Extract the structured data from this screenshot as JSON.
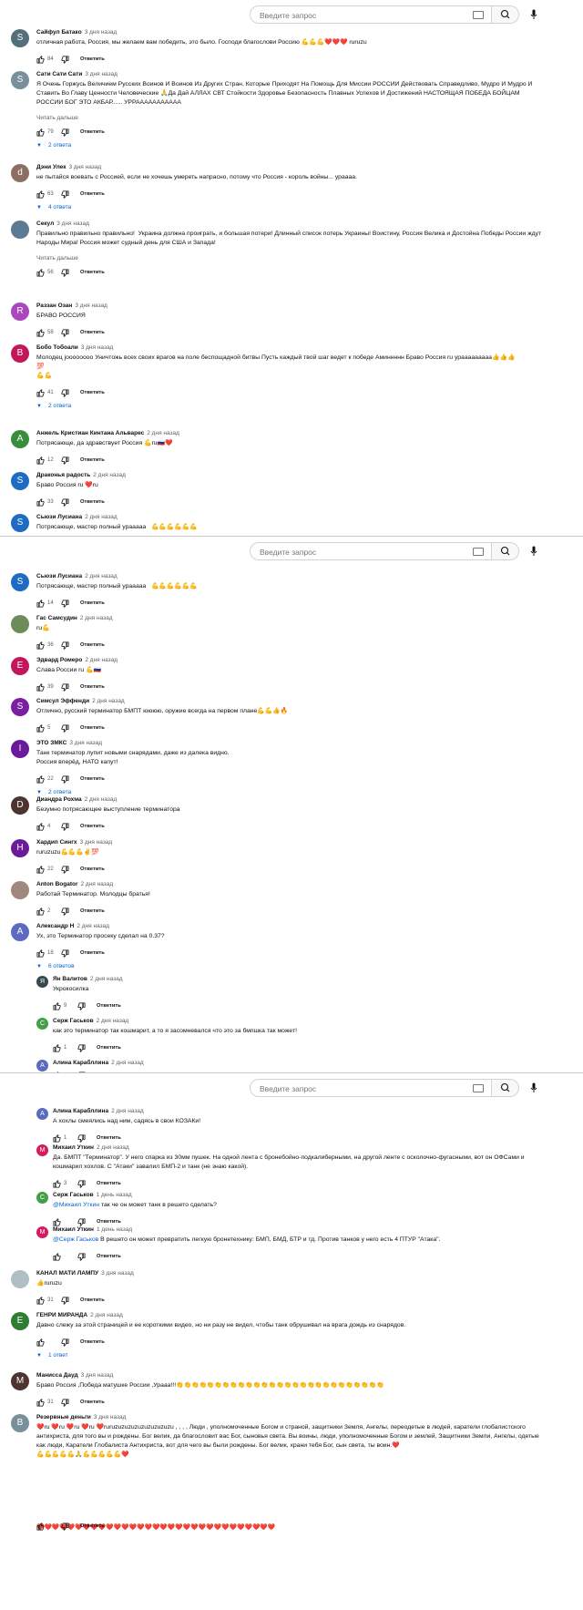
{
  "search": {
    "placeholder": "Введите запрос"
  },
  "segment1": {
    "comments": [
      {
        "initial": "S",
        "color": "#546e7a",
        "author": "Сайфул Батако",
        "date": "3 дня назад",
        "text": "отличная работа, Россия, мы желаем вам победить, это было. Господи благослови Россию 💪💪💪❤️❤️❤️ ruruzu",
        "likes": "84"
      },
      {
        "initial": "S",
        "color": "#78909c",
        "author": "Сати Сати Сати",
        "date": "3 дня назад",
        "text": "Я Очень Горжусь Величием Русских Воинов И Воинов Из Других Стран, Которые Приходят На Помощь Для Миссии РОССИИ Действовать Справедливо, Мудро И Мудро И Ставить Во Главу Ценности Человеческие 🙏Да Дай АЛЛАХ СВТ Стойкости Здоровье Безопасность Плавных Успехов И Достижений НАСТОЯЩАЯ ПОБЕДА БОЙЦАМ РОССИИ БОГ ЭТО АКБАР...... УРРААААААААААА",
        "more": "Читать дальше",
        "likes": "79",
        "replies": "2 ответа"
      },
      {
        "initial": "d",
        "color": "#8d6e63",
        "author": "Дэни Улек",
        "date": "3 дня назад",
        "text": "не пытайся воевать с Россией, если не хочешь умереть напрасно, потому что Россия - король войны... ураааа.",
        "likes": "63",
        "replies": "4 ответа"
      },
      {
        "initial": "",
        "color": "#5d7a94",
        "author": "Секул",
        "date": "3 дня назад",
        "text": "Правильно правильно правильно!  Украина должна проиграть, и большая потери! Длинный список потерь Украины! Воистину, Россия Велика и Достойна Победы России ждут Народы Мира! Россия может судный день для США и Запада!",
        "more": "Читать дальше",
        "likes": "56"
      },
      {
        "initial": "R",
        "color": "#ab47bc",
        "author": "Раззан Озан",
        "date": "3 дня назад",
        "text": "БРАВО РОССИЯ",
        "likes": "58"
      },
      {
        "initial": "B",
        "color": "#c2185b",
        "author": "Бобо Тобоали",
        "date": "3 дня назад",
        "text": "Молодец joooooooo Уничтожь всех своих врагов на поле беспощадной битвы Пусть каждый твой шаг ведет к победе Аминнннн Браво Россия ru урааааааааа👍👍👍\n💯\n💪💪",
        "likes": "41",
        "replies": "2 ответа"
      },
      {
        "initial": "A",
        "color": "#388e3c",
        "author": "Анжель Кристиан Кинтана Альварес",
        "date": "2 дня назад",
        "text": "Потрясающе, да здравствует Россия 💪ru🇷🇺❤️",
        "likes": "12"
      },
      {
        "initial": "S",
        "color": "#1e6bc4",
        "author": "Драконья радость",
        "date": "2 дня назад",
        "text": "Браво Россия ru ❤️ru",
        "likes": "33"
      },
      {
        "initial": "S",
        "color": "#1e6bc4",
        "author": "Сьюзи Лусиана",
        "date": "2 дня назад",
        "text": "Потрясающе, мастер полный урааааа   💪💪💪💪💪💪",
        "likes": ""
      }
    ]
  },
  "segment2": {
    "comments": [
      {
        "initial": "S",
        "color": "#1e6bc4",
        "author": "Сьюзи Лусиана",
        "date": "2 дня назад",
        "text": "Потрясающе, мастер полный урааааа   💪💪💪💪💪💪",
        "likes": "14"
      },
      {
        "initial": "",
        "color": "#6d8c5a",
        "author": "Гас Самсудин",
        "date": "2 дня назад",
        "text": "ru💪",
        "likes": "36"
      },
      {
        "initial": "E",
        "color": "#c2185b",
        "author": "Эдвард Ромеро",
        "date": "2 дня назад",
        "text": "Слава России ru 💪🇷🇺",
        "likes": "39"
      },
      {
        "initial": "S",
        "color": "#7b1fa2",
        "author": "Симсул Эффенди",
        "date": "2 дня назад",
        "text": "Отлично, русский терминатор БМПТ юююю, оружие всегда на первом плане💪💪👍🔥",
        "likes": "5"
      },
      {
        "initial": "I",
        "color": "#6a1b9a",
        "author": "ЭТО ЗМКС",
        "date": "3 дня назад",
        "text": "Танк терминатор лупит новыми снарядами, даже из далека видно.\nРоссия вперёд, НАТО капут!",
        "likes": "22",
        "replies": "2 ответа"
      },
      {
        "initial": "D",
        "color": "#4e342e",
        "author": "Диандра Рохма",
        "date": "2 дня назад",
        "text": "Безумно потрясающее выступление терминатора",
        "likes": "4"
      },
      {
        "initial": "H",
        "color": "#6a1b9a",
        "author": "Хардип Сингх",
        "date": "3 дня назад",
        "text": "ruruzuzu💪💪💪✌️💯",
        "likes": "22"
      },
      {
        "initial": "",
        "color": "#a1887f",
        "author": "Anton Bogator",
        "date": "2 дня назад",
        "text": "Работай Терминатор. Молодцы братья!",
        "likes": "2"
      },
      {
        "initial": "A",
        "color": "#5c6bc0",
        "author": "Александр Н",
        "date": "2 дня назад",
        "text": "Ух, это Терминатор просеку сделал на 0.37?",
        "likes": "18",
        "replies": "6 ответов"
      }
    ],
    "replies": [
      {
        "initial": "Я",
        "color": "#37474f",
        "author": "Ян Валитов",
        "date": "2 дня назад",
        "text": "Укрокосилка",
        "likes": "9"
      },
      {
        "initial": "C",
        "color": "#43a047",
        "author": "Серж Гаськов",
        "date": "2 дня назад",
        "text": "как это терминатор так кошмарит, а то я засомневался что это за бмпшка так может!",
        "likes": "1"
      },
      {
        "initial": "A",
        "color": "#5c6bc0",
        "author": "Алина Карабллина",
        "date": "2 дня назад",
        "text": "",
        "likes": ""
      }
    ]
  },
  "segment3": {
    "replies": [
      {
        "initial": "A",
        "color": "#5c6bc0",
        "author": "Алина Карабллина",
        "date": "2 дня назад",
        "text": "А хохлы смеялись над ним, садясь в свои КОЗАКи!",
        "likes": "1"
      },
      {
        "initial": "M",
        "color": "#d81b60",
        "author": "Михаил Уткин",
        "date": "2 дня назад",
        "text": "Да. БМПТ \"Терминатор\". У него спарка из 30мм пушек. На одной лента с бронебойно-подкалиберными, на другой ленте с осколочно-фугасными, вот он ОФСами и кошмарил хохлов. С \"Атаки\" завалил БМП-2 и танк (не знаю какой).",
        "likes": "3"
      },
      {
        "initial": "C",
        "color": "#43a047",
        "author": "Серж Гаськов",
        "date": "1 день назад",
        "mention": "@Михаил Уткин",
        "text": " так че он может танк в решето сделать?",
        "likes": ""
      },
      {
        "initial": "M",
        "color": "#d81b60",
        "author": "Михаил Уткин",
        "date": "1 день назад",
        "mention": "@Серж Гаськов",
        "text": " В решето он может превратить легкую бронетехнику: БМП, БМД, БТР и тд. Против танков у него есть 4 ПТУР \"Атака\".",
        "likes": ""
      }
    ],
    "comments": [
      {
        "initial": "",
        "color": "#b0bec5",
        "author": "КАНАЛ МАТИ ЛАМПУ",
        "date": "3 дня назад",
        "text": "👍ruruzu",
        "likes": "31"
      },
      {
        "initial": "E",
        "color": "#2e7d32",
        "author": "ГЕНРИ МИРАНДА",
        "date": "2 дня назад",
        "text": "Давно слежу за этой страницей и ее короткими видео, но ни разу не видел, чтобы танк обрушивал на врага дождь из снарядов.",
        "likes": "",
        "replies": "1 ответ"
      },
      {
        "initial": "M",
        "color": "#4e342e",
        "author": "Манисса Дауд",
        "date": "3 дня назад",
        "text": "Браво Россия ,Победа матушке России ,Урааа!!!👏👏👏👏👏👏👏👏👏👏👏👏👏👏👏👏👏👏👏👏👏👏👏👏👏👏👏",
        "likes": "31"
      },
      {
        "initial": "B",
        "color": "#78909c",
        "author": "Резервные деньги",
        "date": "3 дня назад",
        "text": "❤️ru ❤️ru ❤️ru ❤️ru ❤️ruruzuzuzuzuzuzuzuzuzu , , , , Люди , уполномоченные Богом и страной, защитники Земля, Ангелы, переодетые в людей, каратели глобалистского антихриста, для того вы и рождены. Бог велик, да благословит вас Бог, сыновья света. Вы воины, люди, уполномоченные Богом и землей, Защитники Земли, Ангелы, одетые как люди, Каратели Глобалиста Антихриста, вот для чего вы были рождены. Бог велик, храни тебя Бог, сын света, ты воин.❤️\n💪💪💪💪💪🙏💪💪💪💪💪❤️\n\n\n\n\n\n\n\n❤️❤️❤️❤️❤️❤️❤️❤️❤️❤️❤️❤️❤️❤️❤️❤️❤️❤️❤️❤️❤️❤️❤️❤️❤️❤️❤️❤️❤️❤️❤️",
        "likes": ""
      }
    ]
  },
  "labels": {
    "reply": "Ответить"
  }
}
